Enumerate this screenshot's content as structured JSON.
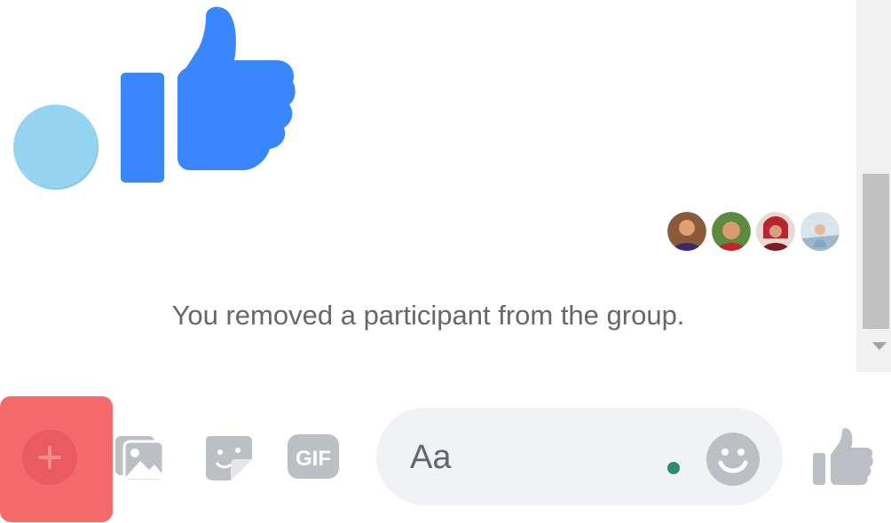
{
  "conversation": {
    "system_message": "You removed a participant from the group.",
    "seen_by": [
      {
        "name": "participant-1",
        "color": "#8a5a3c"
      },
      {
        "name": "participant-2",
        "color": "#5c8a3e"
      },
      {
        "name": "participant-3",
        "color": "#b8262f"
      },
      {
        "name": "participant-4",
        "color": "#9fb7c9"
      }
    ]
  },
  "composer": {
    "placeholder": "Aa",
    "actions": [
      "plus-icon",
      "photo-icon",
      "sticker-icon",
      "gif-icon",
      "emoji-icon",
      "like-icon"
    ]
  },
  "colors": {
    "accent": "#3a86ff",
    "highlight": "#f6696b",
    "icon_gray": "#bcc0c4",
    "text": "#65676b"
  }
}
